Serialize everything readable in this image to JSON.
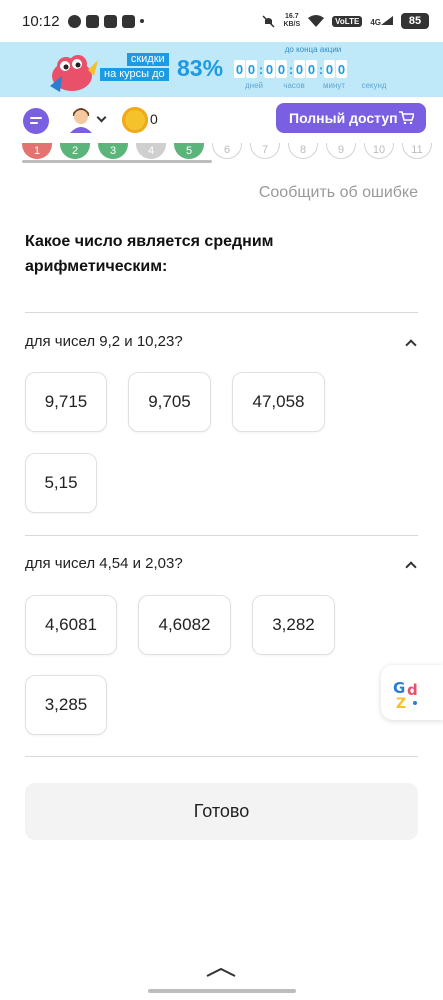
{
  "status_bar": {
    "time": "10:12",
    "speed_value": "16.7",
    "speed_unit": "KB/S",
    "volte": "VoLTE",
    "network": "4G",
    "battery": "85"
  },
  "banner": {
    "tag_line1": "скидки",
    "tag_line2": "на курсы до",
    "percent": "83%",
    "countdown_caption": "до конца акции",
    "digits": [
      "0",
      "0",
      "0",
      "0",
      "0",
      "0",
      "0",
      "0"
    ],
    "units": [
      "дней",
      "часов",
      "минут",
      "секунд"
    ]
  },
  "toolbar": {
    "coin_count": "0",
    "full_access_label": "Полный доступ"
  },
  "progress": {
    "circles": [
      {
        "label": "1",
        "state": "red"
      },
      {
        "label": "2",
        "state": "green"
      },
      {
        "label": "3",
        "state": "green"
      },
      {
        "label": "4",
        "state": "grey"
      },
      {
        "label": "5",
        "state": "green"
      },
      {
        "label": "6",
        "state": "empty"
      },
      {
        "label": "7",
        "state": "empty"
      },
      {
        "label": "8",
        "state": "empty"
      },
      {
        "label": "9",
        "state": "empty"
      },
      {
        "label": "10",
        "state": "empty"
      },
      {
        "label": "11",
        "state": "empty"
      }
    ]
  },
  "report_link": "Сообщить об ошибке",
  "question": {
    "title": "Какое число является средним арифметическим:"
  },
  "groups": [
    {
      "label": "для чисел 9,2 и 10,23?",
      "options": [
        "9,715",
        "9,705",
        "47,058",
        "5,15"
      ]
    },
    {
      "label": "для чисел 4,54 и 2,03?",
      "options": [
        "4,6081",
        "4,6082",
        "3,282",
        "3,285"
      ]
    }
  ],
  "done_label": "Готово",
  "colors": {
    "accent": "#7b5fe2",
    "banner_bg": "#bfe8f9",
    "banner_blue": "#1d9be2",
    "correct": "#5bb479",
    "wrong": "#e27370"
  }
}
